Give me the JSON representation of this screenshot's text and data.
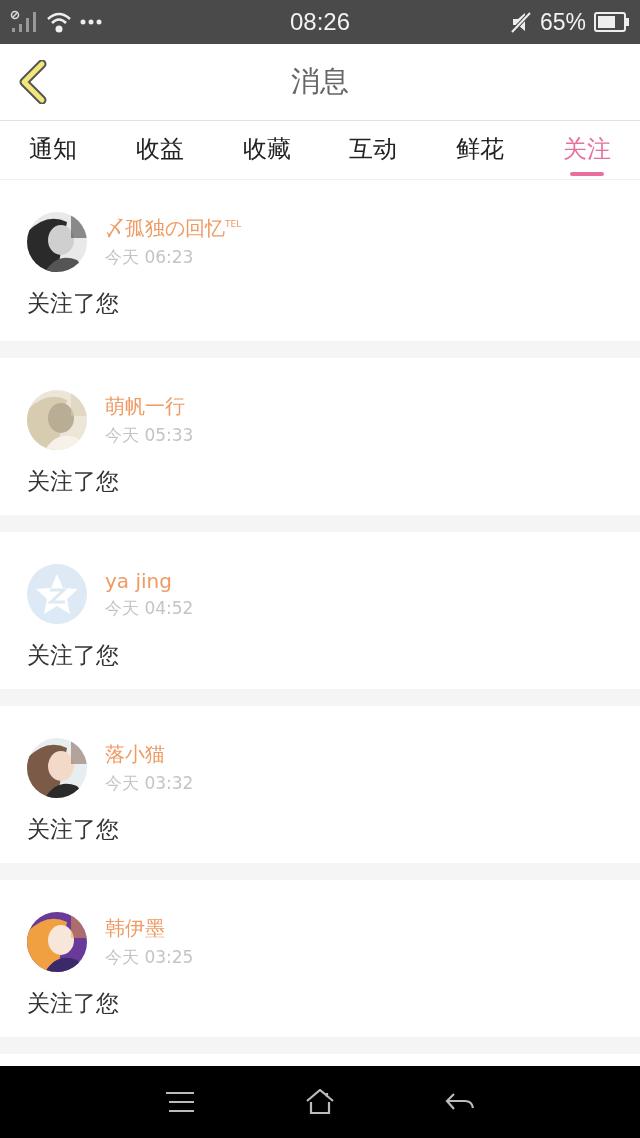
{
  "status_bar": {
    "time": "08:26",
    "battery_text": "65%"
  },
  "header": {
    "title": "消息"
  },
  "tabs": [
    {
      "label": "通知",
      "selected": false
    },
    {
      "label": "收益",
      "selected": false
    },
    {
      "label": "收藏",
      "selected": false
    },
    {
      "label": "互动",
      "selected": false
    },
    {
      "label": "鲜花",
      "selected": false
    },
    {
      "label": "关注",
      "selected": true
    }
  ],
  "messages": [
    {
      "name": "〆孤独の回忆$^{TEL}$",
      "time": "今天 06:23",
      "text": "关注了您"
    },
    {
      "name": "萌帆一行",
      "time": "今天 05:33",
      "text": "关注了您"
    },
    {
      "avatar": {
        "kind": "default"
      },
      "name": "ya jing",
      "time": "今天 04:52",
      "text": "关注了您"
    },
    {
      "name": "落小猫",
      "time": "今天 03:32",
      "text": "关注了您"
    },
    {
      "name": "韩伊墨",
      "time": "今天 03:25",
      "text": "关注了您"
    }
  ]
}
